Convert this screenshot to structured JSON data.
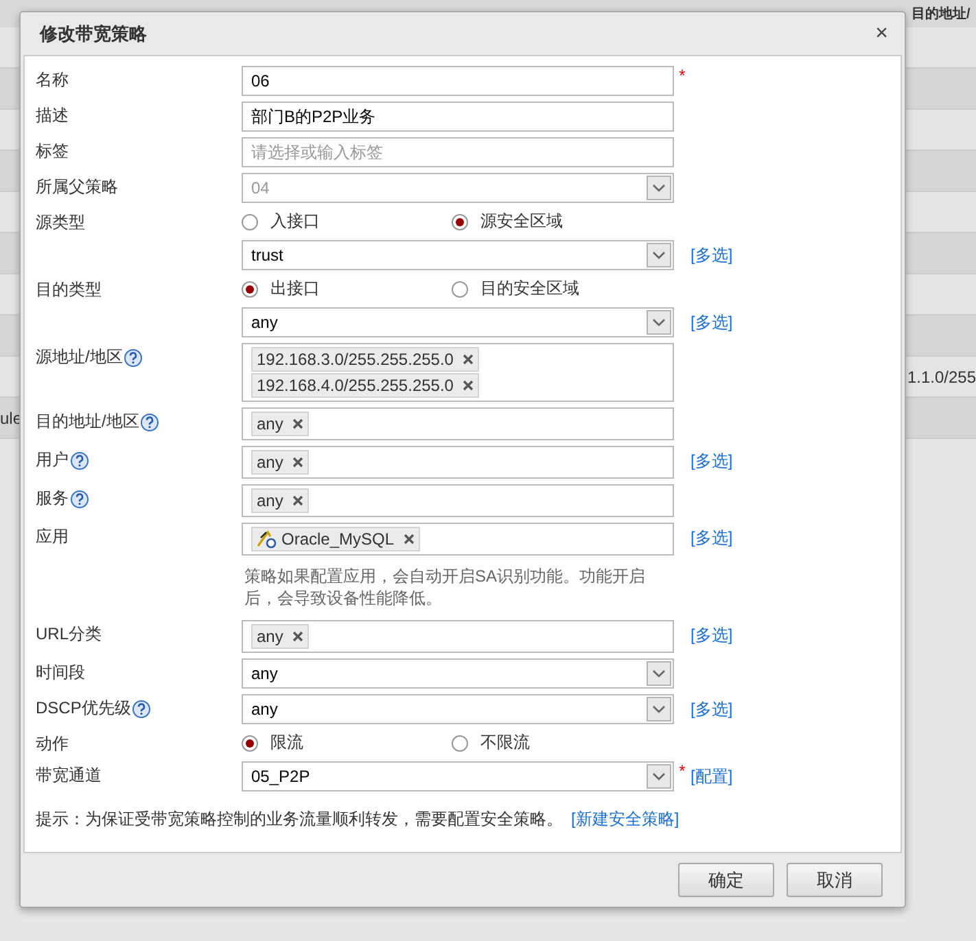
{
  "background": {
    "header": "目的地址/",
    "rows": [
      {
        "right": "1.1.0/255"
      },
      {
        "left": "ule"
      }
    ]
  },
  "dialog": {
    "title": "修改带宽策略",
    "close": "×"
  },
  "fields": [
    {
      "kind": "text",
      "label": "名称",
      "value": "06",
      "required": "*"
    },
    {
      "kind": "text",
      "label": "描述",
      "value": "部门B的P2P业务"
    },
    {
      "kind": "text",
      "label": "标签",
      "placeholder": "请选择或输入标签"
    },
    {
      "kind": "select",
      "label": "所属父策略",
      "value": "04",
      "disabled": true
    },
    {
      "kind": "radio",
      "label": "源类型",
      "options": [
        {
          "label": "入接口",
          "selected": false
        },
        {
          "label": "源安全区域",
          "selected": true
        }
      ]
    },
    {
      "kind": "select",
      "value": "trust",
      "disabled": false,
      "link": "[多选]"
    },
    {
      "kind": "radio",
      "label": "目的类型",
      "options": [
        {
          "label": "出接口",
          "selected": true
        },
        {
          "label": "目的安全区域",
          "selected": false
        }
      ]
    },
    {
      "kind": "select",
      "value": "any",
      "disabled": false,
      "link": "[多选]"
    },
    {
      "kind": "tags",
      "label": "源地址/地区",
      "help": true,
      "tags": [
        {
          "text": "192.168.3.0/255.255.255.0"
        },
        {
          "text": "192.168.4.0/255.255.255.0"
        }
      ]
    },
    {
      "kind": "tags",
      "label": "目的地址/地区",
      "help": true,
      "tags": [
        {
          "text": "any"
        }
      ]
    },
    {
      "kind": "tags",
      "label": "用户",
      "help": true,
      "tags": [
        {
          "text": "any"
        }
      ],
      "link": "[多选]"
    },
    {
      "kind": "tags",
      "label": "服务",
      "help": true,
      "tags": [
        {
          "text": "any"
        }
      ]
    },
    {
      "kind": "tags",
      "label": "应用",
      "tags": [
        {
          "text": "Oracle_MySQL",
          "icon": true
        }
      ],
      "link": "[多选]"
    },
    {
      "kind": "note",
      "text": "策略如果配置应用，会自动开启SA识别功能。功能开启后，会导致设备性能降低。"
    },
    {
      "kind": "tags",
      "label": "URL分类",
      "tags": [
        {
          "text": "any"
        }
      ],
      "link": "[多选]"
    },
    {
      "kind": "select",
      "label": "时间段",
      "value": "any",
      "disabled": false
    },
    {
      "kind": "select",
      "label": "DSCP优先级",
      "help": true,
      "value": "any",
      "disabled": false,
      "link": "[多选]"
    },
    {
      "kind": "radio",
      "label": "动作",
      "options": [
        {
          "label": "限流",
          "selected": true
        },
        {
          "label": "不限流",
          "selected": false
        }
      ]
    },
    {
      "kind": "select",
      "label": "带宽通道",
      "value": "05_P2P",
      "disabled": false,
      "required": "*",
      "link": "[配置]"
    }
  ],
  "hint": {
    "text": "提示：为保证受带宽策略控制的业务流量顺利转发，需要配置安全策略。",
    "link": "[新建安全策略]"
  },
  "buttons": [
    "确定",
    "取消"
  ]
}
